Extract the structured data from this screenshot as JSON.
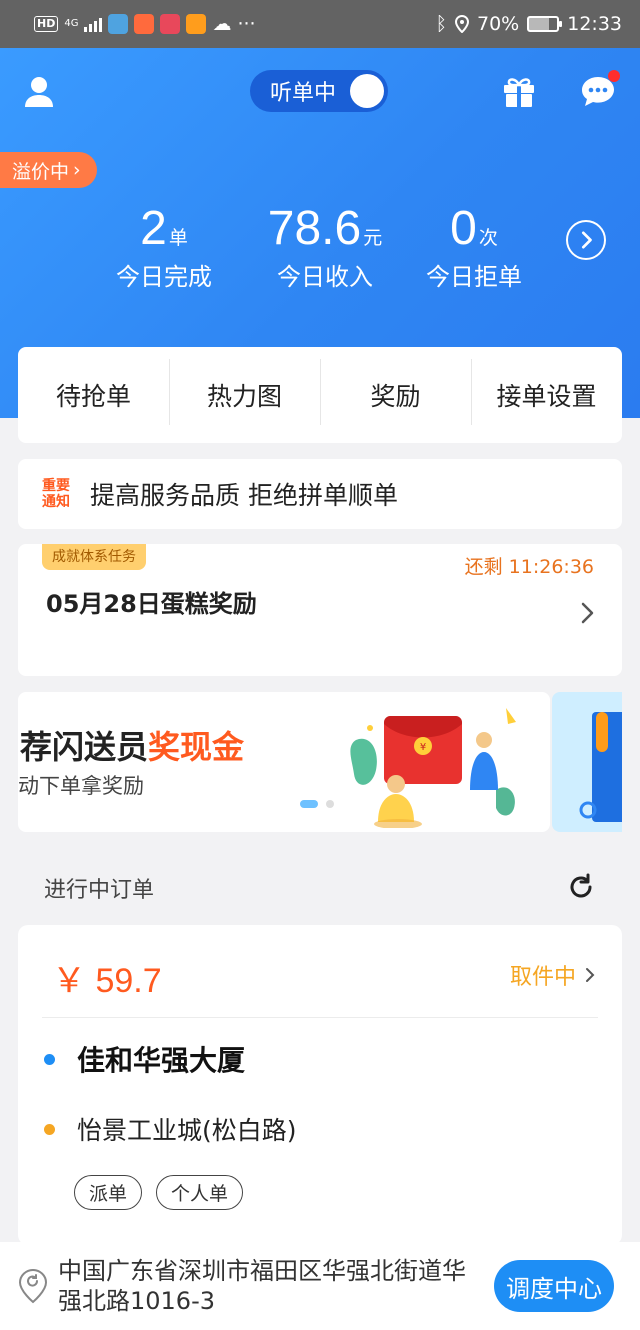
{
  "status_bar": {
    "hd_label": "HD",
    "net_label": "4G",
    "more": "···",
    "battery": "70%",
    "battery_level": 0.7,
    "time": "12:33"
  },
  "header": {
    "listen_toggle_label": "听单中",
    "listen_on": true,
    "premium_tag": "溢价中",
    "premium_chevron": "›",
    "stats": [
      {
        "value": "2",
        "unit": "单",
        "label": "今日完成"
      },
      {
        "value": "78.6",
        "unit": "元",
        "label": "今日收入"
      },
      {
        "value": "0",
        "unit": "次",
        "label": "今日拒单"
      }
    ]
  },
  "tabs": [
    {
      "label": "待抢单"
    },
    {
      "label": "热力图"
    },
    {
      "label": "奖励"
    },
    {
      "label": "接单设置"
    }
  ],
  "notice": {
    "tag_line1": "重要",
    "tag_line2": "通知",
    "text": "提高服务品质  拒绝拼单顺单"
  },
  "task": {
    "tag": "成就体系任务",
    "remaining": "还剩 11:26:36",
    "title": "05月28日蛋糕奖励"
  },
  "banner": {
    "title_prefix": "荐闪送员",
    "title_highlight": "奖现金",
    "subtitle": "动下单拿奖励"
  },
  "ongoing": {
    "section_title": "进行中订单",
    "order": {
      "price": "￥ 59.7",
      "status": "取件中",
      "from": "佳和华强大厦",
      "to": "怡景工业城(松白路)",
      "tags": [
        "派单",
        "个人单"
      ],
      "from_color": "#1e8ef5",
      "to_color": "#f5a623"
    }
  },
  "location": {
    "address": "中国广东省深圳市福田区华强北街道华强北路1016-3",
    "dispatch_button": "调度中心"
  },
  "colors": {
    "brand_blue": "#2f86f3",
    "accent_orange": "#ff5a1f",
    "status_amber": "#f5a623"
  }
}
